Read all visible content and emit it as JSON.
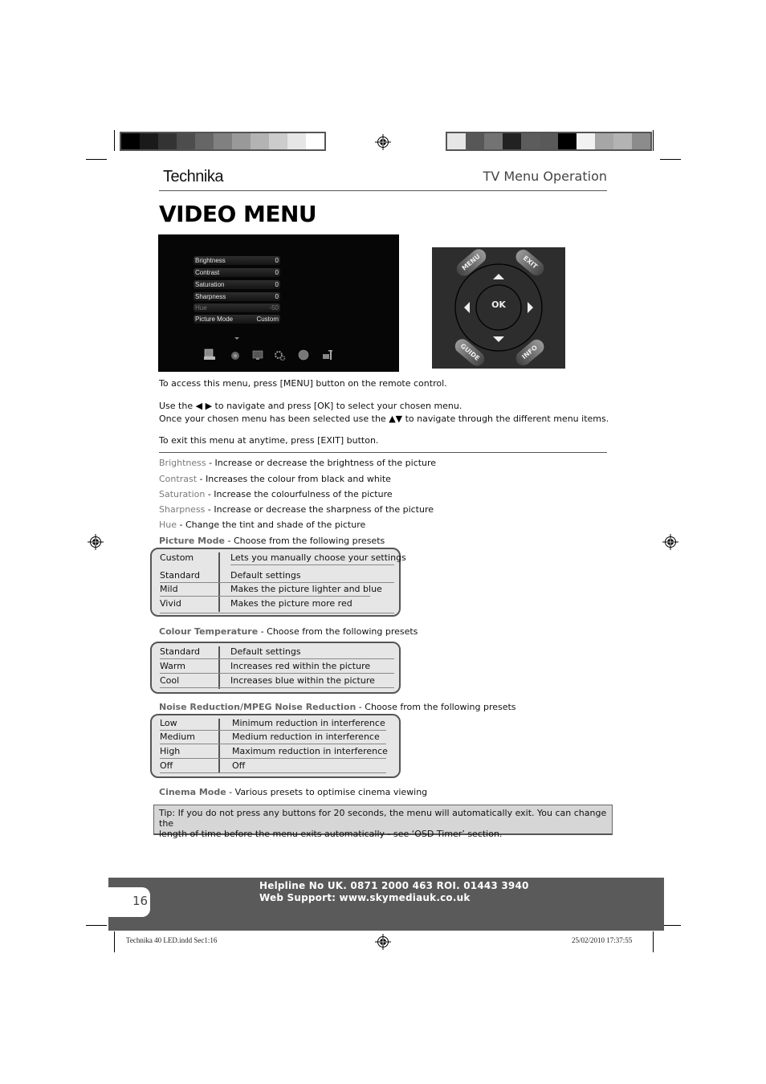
{
  "header": {
    "brand": "Technika",
    "section_title": "TV Menu Operation",
    "page_title": "VIDEO MENU"
  },
  "colors": {
    "left_bar": [
      "#000000",
      "#1a1a1a",
      "#333333",
      "#4d4d4d",
      "#666666",
      "#808080",
      "#999999",
      "#b3b3b3",
      "#cccccc",
      "#e6e6e6",
      "#ffffff"
    ],
    "right_bar": [
      "#e6e6e6",
      "#575757",
      "#737373",
      "#222222",
      "#5c5c5c",
      "#595959",
      "#000000",
      "#f2f2f2",
      "#a6a6a6",
      "#b3b3b3",
      "#8c8c8c"
    ],
    "footer_band": "#5a5a5a",
    "tip_bg": "#d6d6d6",
    "table_bg": "#e6e6e6"
  },
  "tv_menu": {
    "items": [
      {
        "label": "Brightness",
        "value": "0"
      },
      {
        "label": "Contrast",
        "value": "0"
      },
      {
        "label": "Saturation",
        "value": "0"
      },
      {
        "label": "Sharpness",
        "value": "0"
      },
      {
        "label": "Hue",
        "value": "-50",
        "disabled": true
      },
      {
        "label": "Picture Mode",
        "value": "Custom"
      }
    ],
    "icons": [
      "picture-icon",
      "sound-icon",
      "screen-icon",
      "setup-icon",
      "time-icon",
      "lock-icon"
    ]
  },
  "remote": {
    "menu": "MENU",
    "exit": "EXIT",
    "guide": "GUIDE",
    "info": "INFO",
    "ok": "OK"
  },
  "instructions": {
    "access": "To access this menu, press [MENU] button on the remote control.",
    "nav_prefix": "Use the",
    "nav_lr_glyph": "◀ ▶",
    "nav_suffix": "to navigate and press [OK] to select your chosen menu.",
    "select_prefix": "Once your chosen menu has been selected use the",
    "nav_ud_glyph": "▲▼",
    "select_suffix": "to navigate through the different menu items.",
    "exit": "To exit this menu at anytime, press [EXIT] button."
  },
  "descriptions": [
    {
      "term": "Brightness",
      "text": " - Increase or decrease the brightness of the picture"
    },
    {
      "term": "Contrast",
      "text": " - Increases the colour from black and white"
    },
    {
      "term": "Saturation",
      "text": " - Increase the colourfulness of the picture"
    },
    {
      "term": "Sharpness",
      "text": " - Increase or decrease the sharpness of the picture"
    },
    {
      "term": "Hue",
      "text": " - Change the tint and shade of the picture"
    }
  ],
  "picture_mode": {
    "term": "Picture Mode",
    "text": " - Choose from the following presets",
    "rows": [
      {
        "k": "Custom",
        "v": "Lets you manually choose your settings"
      },
      {
        "k": "Standard",
        "v": "Default settings"
      },
      {
        "k": "Mild",
        "v": "Makes the picture lighter and blue"
      },
      {
        "k": "Vivid",
        "v": "Makes the picture more red"
      }
    ]
  },
  "colour_temperature": {
    "term": "Colour Temperature",
    "text": " - Choose from the following presets",
    "rows": [
      {
        "k": "Standard",
        "v": "Default settings"
      },
      {
        "k": "Warm",
        "v": "Increases red within the picture"
      },
      {
        "k": "Cool",
        "v": "Increases blue within the picture"
      }
    ]
  },
  "noise_reduction": {
    "term": "Noise Reduction/MPEG Noise Reduction",
    "text": " - Choose from the following presets",
    "rows": [
      {
        "k": "Low",
        "v": "Minimum reduction in interference"
      },
      {
        "k": "Medium",
        "v": "Medium reduction in interference"
      },
      {
        "k": "High",
        "v": "Maximum reduction in interference"
      },
      {
        "k": "Off",
        "v": "Off"
      }
    ]
  },
  "cinema_mode": {
    "term": "Cinema Mode",
    "text": " - Various presets to optimise cinema viewing"
  },
  "tip": {
    "line1": "Tip: If you do not press any buttons for 20 seconds, the menu will automatically exit. You can change the",
    "line2": "length of time before the menu exits automatically - see ‘OSD Timer’ section."
  },
  "footer": {
    "page_number": "16",
    "helpline": "Helpline No UK. 0871 2000 463   ROI. 01443 3940",
    "web_support": "Web Support: www.skymediauk.co.uk"
  },
  "slug": {
    "file": "Technika 40 LED.indd   Sec1:16",
    "datetime": "25/02/2010   17:37:55"
  }
}
